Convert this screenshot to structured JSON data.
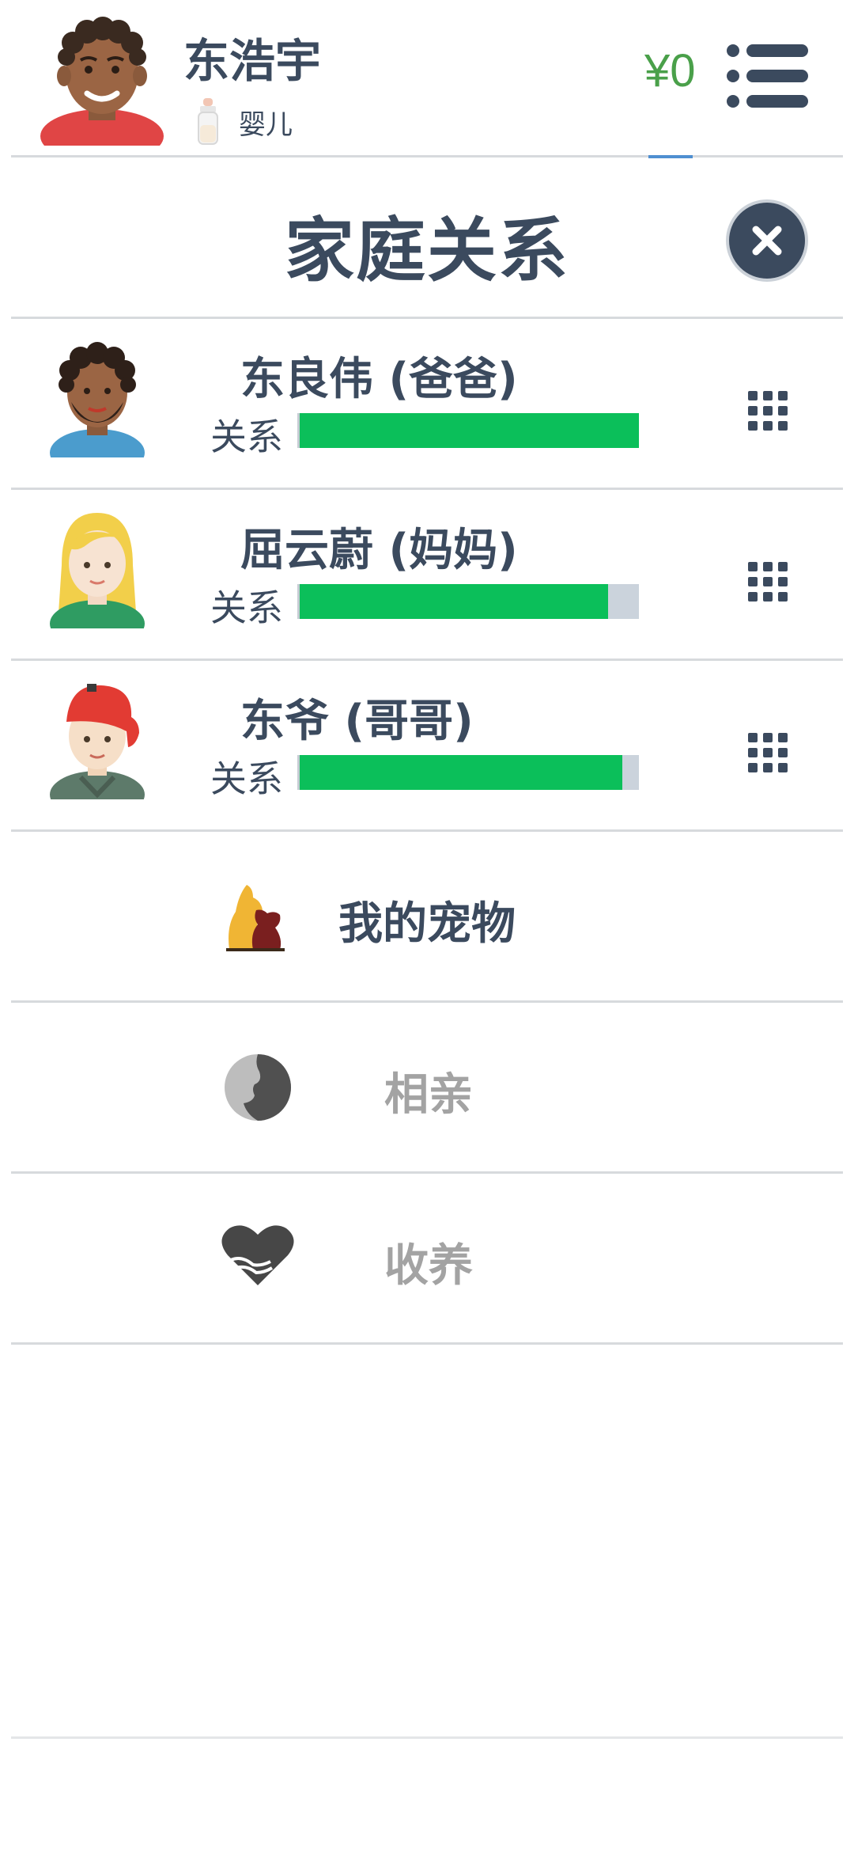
{
  "header": {
    "name": "东浩宇",
    "stage": "婴儿",
    "money": "¥0"
  },
  "title": "家庭关系",
  "family": [
    {
      "name": "东良伟 (爸爸)",
      "relation_label": "关系",
      "relation_level": 1.0
    },
    {
      "name": "屈云蔚 (妈妈)",
      "relation_label": "关系",
      "relation_level": 0.91
    },
    {
      "name": "东爷 (哥哥)",
      "relation_label": "关系",
      "relation_level": 0.95
    }
  ],
  "menu": {
    "pets": "我的宠物",
    "dating": "相亲",
    "adopt": "收养"
  },
  "colors": {
    "primary_text": "#3b4a5e",
    "money": "#4aa04a",
    "relation_bar": "#0bbf5a",
    "disabled_text": "#a3a3a3"
  }
}
